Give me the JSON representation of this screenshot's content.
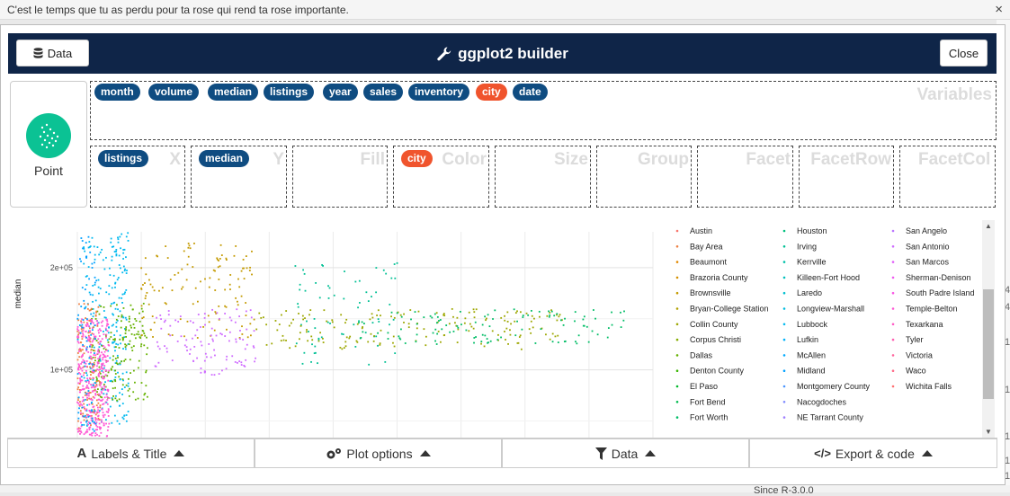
{
  "banner": {
    "text": "C'est le temps que tu as perdu pour ta rose qui rend ta rose importante.",
    "close": "×"
  },
  "header": {
    "data_button": "Data",
    "title": "ggplot2 builder",
    "close_button": "Close"
  },
  "geom": {
    "label": "Point"
  },
  "variables": {
    "ghost_label": "Variables",
    "pills": [
      {
        "name": "month",
        "color": "#0f4c81"
      },
      {
        "name": "volume",
        "color": "#0f4c81"
      },
      {
        "name": "median",
        "color": "#0f4c81"
      },
      {
        "name": "listings",
        "color": "#0f4c81"
      },
      {
        "name": "year",
        "color": "#0f4c81"
      },
      {
        "name": "sales",
        "color": "#0f4c81"
      },
      {
        "name": "inventory",
        "color": "#0f4c81"
      },
      {
        "name": "city",
        "color": "#f0542d"
      },
      {
        "name": "date",
        "color": "#0f4c81"
      }
    ]
  },
  "aesthetics": [
    {
      "label": "X",
      "value": "listings",
      "color": "#0f4c81"
    },
    {
      "label": "Y",
      "value": "median",
      "color": "#0f4c81"
    },
    {
      "label": "Fill",
      "value": "",
      "color": ""
    },
    {
      "label": "Color",
      "value": "city",
      "color": "#f0542d"
    },
    {
      "label": "Size",
      "value": "",
      "color": ""
    },
    {
      "label": "Group",
      "value": "",
      "color": ""
    },
    {
      "label": "Facet",
      "value": "",
      "color": ""
    },
    {
      "label": "FacetRow",
      "value": "",
      "color": ""
    },
    {
      "label": "FacetCol",
      "value": "",
      "color": ""
    }
  ],
  "chart_data": {
    "type": "scatter",
    "ylabel": "median",
    "yticks": [
      "2e+05",
      "1e+05"
    ],
    "ytick_values": [
      200000,
      100000
    ],
    "ylim": [
      32000,
      235000
    ],
    "xlim": [
      0,
      45000
    ],
    "legend_columns": [
      [
        "Austin",
        "Bay Area",
        "Beaumont",
        "Brazoria County",
        "Brownsville",
        "Bryan-College Station",
        "Collin County",
        "Corpus Christi",
        "Dallas",
        "Denton County",
        "El Paso",
        "Fort Bend",
        "Fort Worth"
      ],
      [
        "Houston",
        "Irving",
        "Kerrville",
        "Killeen-Fort Hood",
        "Laredo",
        "Longview-Marshall",
        "Lubbock",
        "Lufkin",
        "McAllen",
        "Midland",
        "Montgomery County",
        "Nacogdoches",
        "NE Tarrant County"
      ],
      [
        "San Angelo",
        "San Antonio",
        "San Marcos",
        "Sherman-Denison",
        "South Padre Island",
        "Temple-Belton",
        "Texarkana",
        "Tyler",
        "Victoria",
        "Waco",
        "Wichita Falls"
      ]
    ],
    "legend_colors": [
      [
        "#f8766d",
        "#ee8043",
        "#e38900",
        "#d59100",
        "#c49a00",
        "#b2a100",
        "#9da700",
        "#85ad00",
        "#66b200",
        "#39b600",
        "#00b92a",
        "#00bb4e",
        "#00bd66"
      ],
      [
        "#00bf7d",
        "#00c094",
        "#00c1a9",
        "#00c0bc",
        "#00bfcf",
        "#00bde0",
        "#00b9ef",
        "#00b2fb",
        "#00aaff",
        "#00a0ff",
        "#4a95ff",
        "#7f8bff",
        "#a080ff"
      ],
      [
        "#ba75ff",
        "#cf6bff",
        "#e160f9",
        "#ef5af0",
        "#f957e4",
        "#ff57d5",
        "#ff59c4",
        "#ff5fb1",
        "#ff659d",
        "#ff6a87",
        "#ff6f70"
      ]
    ],
    "clusters": [
      {
        "name": "Houston",
        "color": "#00b9ef",
        "n": 240,
        "x": [
          500,
          4000
        ],
        "y": [
          45000,
          235000
        ]
      },
      {
        "name": "Dallas",
        "color": "#66b200",
        "n": 180,
        "x": [
          1000,
          5500
        ],
        "y": [
          70000,
          165000
        ]
      },
      {
        "name": "Austin",
        "color": "#c49a00",
        "n": 120,
        "x": [
          5000,
          14000
        ],
        "y": [
          130000,
          225000
        ]
      },
      {
        "name": "San Antonio",
        "color": "#cf6bff",
        "n": 110,
        "x": [
          6000,
          14000
        ],
        "y": [
          95000,
          160000
        ]
      },
      {
        "name": "Collin County",
        "color": "#00c094",
        "n": 70,
        "x": [
          17000,
          25000
        ],
        "y": [
          105000,
          205000
        ]
      },
      {
        "name": "Fort Worth",
        "color": "#9da700",
        "n": 170,
        "x": [
          14000,
          38000
        ],
        "y": [
          120000,
          160000
        ]
      },
      {
        "name": "Bay Area",
        "color": "#00bd66",
        "n": 110,
        "x": [
          22000,
          43000
        ],
        "y": [
          125000,
          160000
        ]
      },
      {
        "name": "Fort Bend",
        "color": "#ee8043",
        "n": 140,
        "x": [
          0,
          1800
        ],
        "y": [
          40000,
          165000
        ]
      },
      {
        "name": "Corpus Christi",
        "color": "#ff57d5",
        "n": 360,
        "x": [
          0,
          2500
        ],
        "y": [
          35000,
          150000
        ]
      },
      {
        "name": "El Paso",
        "color": "#00a0ff",
        "n": 80,
        "x": [
          0,
          1500
        ],
        "y": [
          40000,
          235000
        ]
      }
    ]
  },
  "toolbar": {
    "labels_title": "Labels & Title",
    "plot_options": "Plot options",
    "data": "Data",
    "export_code": "Export & code"
  },
  "background": {
    "bottom_text": "Since R-3.0.0",
    "right_digits": [
      "4",
      "4",
      "1",
      "1",
      "1",
      "1",
      "1"
    ]
  }
}
